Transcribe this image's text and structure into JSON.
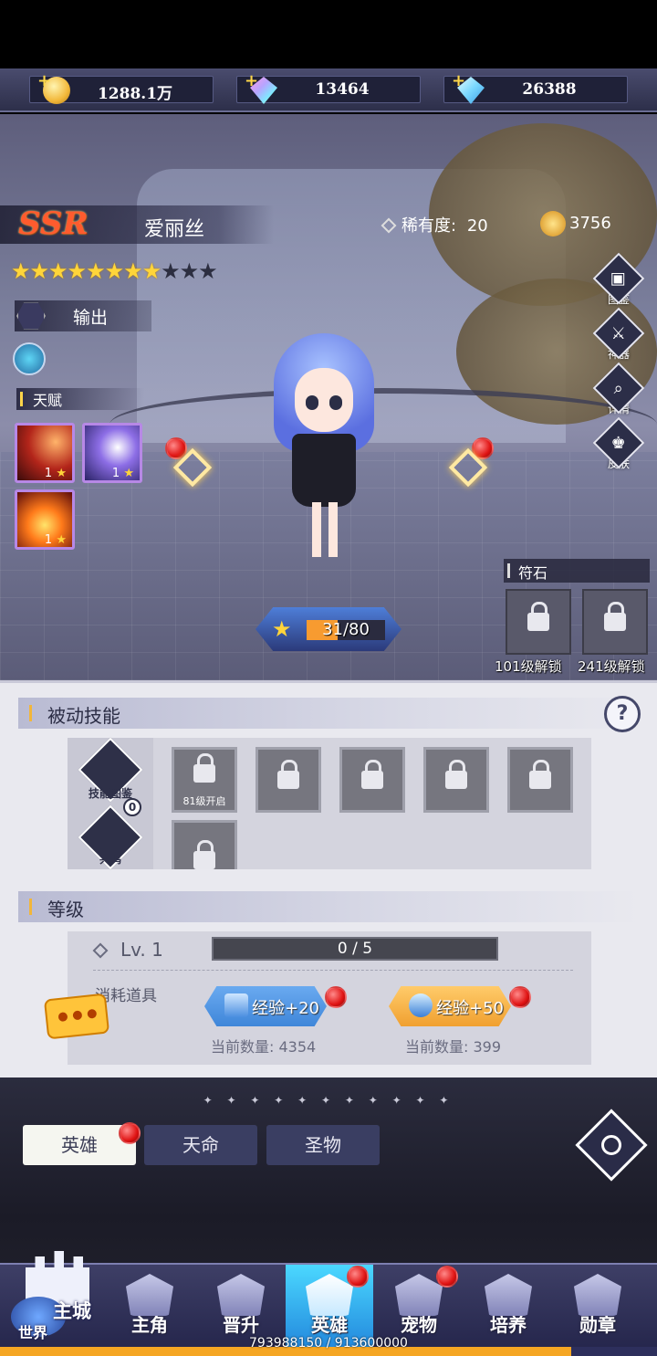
{
  "resources": [
    {
      "icon": "gold-coin-icon",
      "value": "1288.1万"
    },
    {
      "icon": "rainbow-gem-icon",
      "value": "13464"
    },
    {
      "icon": "blue-diamond-icon",
      "value": "26388"
    }
  ],
  "hero": {
    "rarity_badge": "SSR",
    "name": "爱丽丝",
    "rarity_label": "稀有度:",
    "rarity_value": "20",
    "power": "3756",
    "stars_on": 8,
    "stars_total": 11,
    "role": "输出",
    "talent_header": "天赋",
    "talents": [
      {
        "level": "1",
        "star": "★"
      },
      {
        "level": "1",
        "star": "★"
      },
      {
        "level": "1",
        "star": "★"
      }
    ],
    "level_progress": "31/80",
    "level_progress_fraction": 0.39
  },
  "side_buttons": [
    {
      "icon": "codex-icon",
      "label": "图鉴"
    },
    {
      "icon": "artifact-icon",
      "label": "神器"
    },
    {
      "icon": "details-icon",
      "label": "详情"
    },
    {
      "icon": "skin-icon",
      "label": "皮肤"
    }
  ],
  "runes": {
    "header": "符石",
    "slots": [
      {
        "unlock": "101级解锁"
      },
      {
        "unlock": "241级解锁"
      }
    ]
  },
  "passive": {
    "header": "被动技能",
    "help": "?",
    "codex_label": "技能图鉴",
    "resonance_label": "共鸣",
    "resonance_count": "0",
    "slot_note": "81级开启"
  },
  "level": {
    "header": "等级",
    "lv_text": "Lv. 1",
    "exp_text": "0 / 5",
    "consume_label": "消耗道具",
    "items": [
      {
        "label": "经验+20",
        "qty": "当前数量: 4354",
        "color": "#3f86d9"
      },
      {
        "label": "经验+50",
        "qty": "当前数量: 399",
        "color": "#f0a030"
      }
    ]
  },
  "divider": "✦ ✦ ✦ ✦ ✦ ✦ ✦ ✦ ✦ ✦ ✦",
  "tabs": [
    "英雄",
    "天命",
    "圣物"
  ],
  "nav": {
    "main_city": "主城",
    "world": "世界",
    "items": [
      "主角",
      "晋升",
      "英雄",
      "宠物",
      "培养",
      "勋章"
    ],
    "progress_text": "793988150 / 913600000",
    "progress_fraction": 0.869
  },
  "colors": {
    "accent_gold": "#ffd43a",
    "ssr_red": "#ff5b2e",
    "notification_red": "#e01414",
    "active_tab": "#f5f6f0",
    "nav_active": "#1e7fd9"
  }
}
